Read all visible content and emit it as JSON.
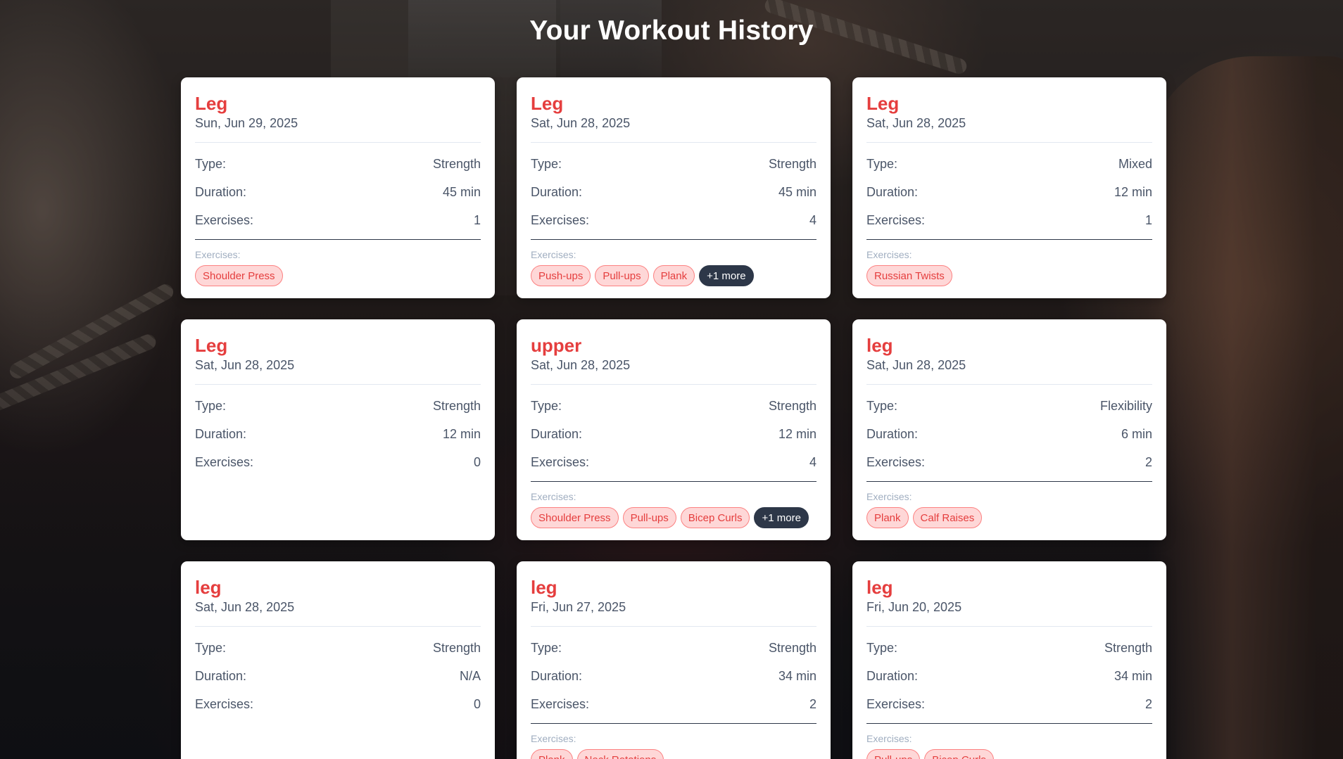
{
  "page": {
    "title": "Your Workout History"
  },
  "labels": {
    "type": "Type:",
    "duration": "Duration:",
    "exercises": "Exercises:",
    "exercises_section": "Exercises:"
  },
  "workouts": [
    {
      "name": "Leg",
      "date": "Sun, Jun 29, 2025",
      "type": "Strength",
      "duration": "45 min",
      "exercise_count": "1",
      "exercises": [
        "Shoulder Press"
      ],
      "more": ""
    },
    {
      "name": "Leg",
      "date": "Sat, Jun 28, 2025",
      "type": "Strength",
      "duration": "45 min",
      "exercise_count": "4",
      "exercises": [
        "Push-ups",
        "Pull-ups",
        "Plank"
      ],
      "more": "+1 more"
    },
    {
      "name": "Leg",
      "date": "Sat, Jun 28, 2025",
      "type": "Mixed",
      "duration": "12 min",
      "exercise_count": "1",
      "exercises": [
        "Russian Twists"
      ],
      "more": ""
    },
    {
      "name": "Leg",
      "date": "Sat, Jun 28, 2025",
      "type": "Strength",
      "duration": "12 min",
      "exercise_count": "0",
      "exercises": [],
      "more": ""
    },
    {
      "name": "upper",
      "date": "Sat, Jun 28, 2025",
      "type": "Strength",
      "duration": "12 min",
      "exercise_count": "4",
      "exercises": [
        "Shoulder Press",
        "Pull-ups",
        "Bicep Curls"
      ],
      "more": "+1 more"
    },
    {
      "name": "leg",
      "date": "Sat, Jun 28, 2025",
      "type": "Flexibility",
      "duration": "6 min",
      "exercise_count": "2",
      "exercises": [
        "Plank",
        "Calf Raises"
      ],
      "more": ""
    },
    {
      "name": "leg",
      "date": "Sat, Jun 28, 2025",
      "type": "Strength",
      "duration": "N/A",
      "exercise_count": "0",
      "exercises": [],
      "more": ""
    },
    {
      "name": "leg",
      "date": "Fri, Jun 27, 2025",
      "type": "Strength",
      "duration": "34 min",
      "exercise_count": "2",
      "exercises": [
        "Plank",
        "Neck Rotations"
      ],
      "more": ""
    },
    {
      "name": "leg",
      "date": "Fri, Jun 20, 2025",
      "type": "Strength",
      "duration": "34 min",
      "exercise_count": "2",
      "exercises": [
        "Pull-ups",
        "Bicep Curls"
      ],
      "more": ""
    }
  ]
}
